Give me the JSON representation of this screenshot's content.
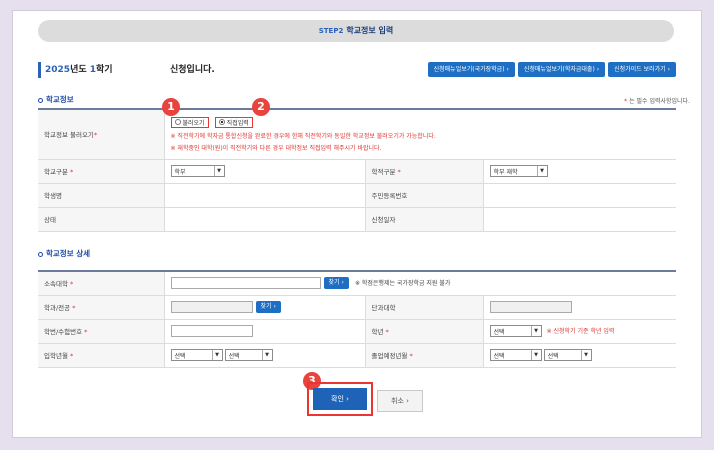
{
  "header": {
    "step": "STEP2",
    "title": "학교정보 입력"
  },
  "semester": {
    "year": "2025",
    "year_suffix": "년도",
    "term": "1",
    "term_suffix": "학기",
    "status": "신청입니다."
  },
  "top_buttons": [
    "신청매뉴얼보기(국가장학금) ›",
    "신청매뉴얼보기(학자금대출) ›",
    "신청가이드 보러가기 ›"
  ],
  "required_note": {
    "star": "*",
    "text": " 는 필수 입력사항입니다."
  },
  "school_info": {
    "title": "학교정보",
    "load_label": "학교정보 불러오기",
    "radio_load": "불러오기",
    "radio_direct": "직접입력",
    "notice1": "※ 직전학기에 학자금 통합신청을 완료한 경우에 한해 직전학기와 동일한 학교정보 불러오기가 가능합니다.",
    "notice2": "※ 재학중인 대학(원)이 직전학기와 다른 경우 대학정보 직접입력 해주시기 바랍니다.",
    "school_type_label": "학교구분",
    "school_type_value": "학부",
    "status_type_label": "학적구분",
    "status_type_value": "학부 재학",
    "student_name_label": "학생명",
    "resident_no_label": "주민등록번호",
    "state_label": "상태",
    "apply_date_label": "신청일자"
  },
  "school_detail": {
    "title": "학교정보 상세",
    "university_label": "소속대학",
    "find_label": "찾기 ›",
    "university_note": "※ 학점은행제는 국가장학금 지원 불가",
    "major_label": "학과/전공",
    "college_label": "단과대학",
    "student_no_label": "학번/수험번호",
    "grade_label": "학년",
    "grade_value": "선택",
    "grade_note": "※ 신청학기 기준 학년 입력",
    "admission_label": "입학년월",
    "admission_year": "선택",
    "admission_month": "선택",
    "graduation_label": "졸업예정년월",
    "graduation_year": "선택",
    "graduation_month": "선택"
  },
  "actions": {
    "confirm": "확인   ›",
    "cancel": "취소   ›"
  },
  "badges": [
    "1",
    "2",
    "3"
  ],
  "colors": {
    "accent": "#1e6fc3",
    "highlight": "#e9433e",
    "background": "#e6e0ee"
  }
}
